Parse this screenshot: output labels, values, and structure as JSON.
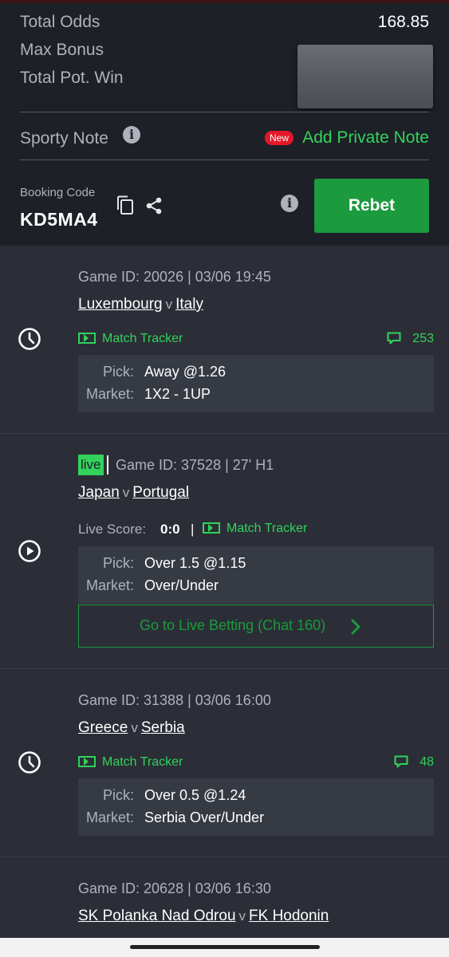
{
  "summary": {
    "total_odds_label": "Total Odds",
    "total_odds_value": "168.85",
    "max_bonus_label": "Max Bonus",
    "total_pot_win_label": "Total Pot. Win"
  },
  "note": {
    "label": "Sporty Note",
    "new_badge": "New",
    "add_private_note": "Add Private Note"
  },
  "booking": {
    "label": "Booking Code",
    "code": "KD5MA4",
    "rebet_label": "Rebet"
  },
  "labels": {
    "pick": "Pick:",
    "market": "Market:",
    "match_tracker": "Match Tracker",
    "live_score": "Live Score:",
    "live": "live",
    "v": "v",
    "sep": "|"
  },
  "games": [
    {
      "status": "scheduled",
      "game_id": "Game ID: 20026 | 03/06 19:45",
      "home": "Luxembourg",
      "away": "Italy",
      "chat_count": "253",
      "pick": "Away @1.26",
      "market": "1X2 - 1UP"
    },
    {
      "status": "live",
      "game_id": "Game ID: 37528 | 27' H1",
      "home": "Japan",
      "away": "Portugal",
      "live_score": "0:0",
      "pick": "Over 1.5 @1.15",
      "market": "Over/Under",
      "go_live_label": "Go to Live Betting (Chat 160)"
    },
    {
      "status": "scheduled",
      "game_id": "Game ID: 31388 | 03/06 16:00",
      "home": "Greece",
      "away": "Serbia",
      "chat_count": "48",
      "pick": "Over 0.5 @1.24",
      "market": "Serbia Over/Under"
    },
    {
      "status": "scheduled",
      "game_id": "Game ID: 20628 | 03/06 16:30",
      "home": "SK Polanka Nad Odrou",
      "away": "FK Hodonin"
    }
  ],
  "colors": {
    "accent_green": "#31d35c",
    "button_green": "#1b9a3e",
    "badge_red": "#e41827"
  }
}
